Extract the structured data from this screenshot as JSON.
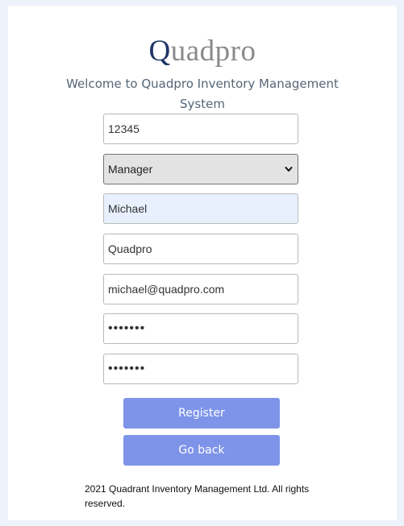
{
  "brand": {
    "initial": "Q",
    "rest": "uadpro"
  },
  "welcome": "Welcome to Quadpro Inventory Management System",
  "form": {
    "id_value": "12345",
    "role_selected": "Manager",
    "name_value": "Michael",
    "company_value": "Quadpro",
    "email_value": "michael@quadpro.com",
    "password_value": "1234567",
    "confirm_password_value": "1234567"
  },
  "buttons": {
    "register": "Register",
    "go_back": "Go back"
  },
  "footer": "2021 Quadrant Inventory Management Ltd. All rights reserved.",
  "colors": {
    "page_background": "#eef2fb",
    "button": "#7e94e9",
    "brand_initial": "#1f3566",
    "autofill_field": "#e8f0fe"
  },
  "icons": {
    "select_arrow": "chevron-down-icon"
  }
}
